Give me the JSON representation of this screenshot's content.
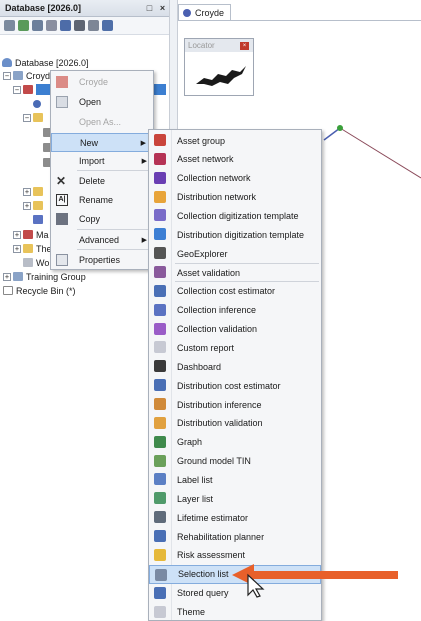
{
  "database_pane": {
    "title": "Database [2026.0]",
    "title_buttons": [
      "□",
      "×"
    ],
    "tree": {
      "root": "Database [2026.0]",
      "croydon_partial": "Croyd",
      "group_partial_1": "Ma",
      "group_partial_2": "The",
      "group_partial_3": "Wo",
      "training_group": "Training Group",
      "recycle_bin": "Recycle Bin (*)"
    }
  },
  "map_pane": {
    "tab_label": "Croyde",
    "locator_title": "Locator"
  },
  "context_menu": {
    "items": [
      {
        "label": "Croyde",
        "disabled": true
      },
      {
        "label": "Open",
        "disabled": false
      },
      {
        "label": "Open As...",
        "disabled": true
      },
      {
        "label": "New",
        "disabled": false,
        "submenu": true,
        "highlighted": true
      },
      {
        "label": "Import",
        "disabled": false,
        "submenu": true
      },
      {
        "label": "Delete",
        "disabled": false
      },
      {
        "label": "Rename",
        "disabled": false
      },
      {
        "label": "Copy",
        "disabled": false
      },
      {
        "label": "Advanced",
        "disabled": false,
        "submenu": true
      },
      {
        "label": "Properties",
        "disabled": false
      }
    ]
  },
  "new_submenu": {
    "items": [
      {
        "label": "Asset group",
        "icon": "asset-group-icon",
        "color": "#c9443b"
      },
      {
        "label": "Asset network",
        "icon": "asset-network-icon",
        "color": "#b53355"
      },
      {
        "label": "Collection network",
        "icon": "collection-network-icon",
        "color": "#6a3fb3"
      },
      {
        "label": "Distribution network",
        "icon": "distribution-network-icon",
        "color": "#e8a43a"
      },
      {
        "label": "Collection digitization template",
        "icon": "collection-template-icon",
        "color": "#7a6cc9"
      },
      {
        "label": "Distribution digitization template",
        "icon": "distribution-template-icon",
        "color": "#3d7fd4"
      },
      {
        "label": "GeoExplorer",
        "icon": "geoexplorer-icon",
        "color": "#555555"
      },
      {
        "label": "Asset validation",
        "icon": "asset-validation-icon",
        "color": "#8a5a9c"
      },
      {
        "label": "Collection cost estimator",
        "icon": "collection-cost-icon",
        "color": "#4a6fb5"
      },
      {
        "label": "Collection inference",
        "icon": "collection-inference-icon",
        "color": "#5a72c2"
      },
      {
        "label": "Collection validation",
        "icon": "collection-validation-icon",
        "color": "#9a5cc7"
      },
      {
        "label": "Custom report",
        "icon": "custom-report-icon",
        "color": "#c7c9d3"
      },
      {
        "label": "Dashboard",
        "icon": "dashboard-icon",
        "color": "#3a3a3a"
      },
      {
        "label": "Distribution cost estimator",
        "icon": "distribution-cost-icon",
        "color": "#4a6fb5"
      },
      {
        "label": "Distribution inference",
        "icon": "distribution-inference-icon",
        "color": "#d08a3a"
      },
      {
        "label": "Distribution validation",
        "icon": "distribution-validation-icon",
        "color": "#e1a13f"
      },
      {
        "label": "Graph",
        "icon": "graph-icon",
        "color": "#3f8a4c"
      },
      {
        "label": "Ground model TIN",
        "icon": "ground-model-icon",
        "color": "#6aa05a"
      },
      {
        "label": "Label list",
        "icon": "label-list-icon",
        "color": "#5b7fc4"
      },
      {
        "label": "Layer list",
        "icon": "layer-list-icon",
        "color": "#4f9a6a"
      },
      {
        "label": "Lifetime estimator",
        "icon": "lifetime-estimator-icon",
        "color": "#5f6b7a"
      },
      {
        "label": "Rehabilitation planner",
        "icon": "rehabilitation-planner-icon",
        "color": "#4a6fb5"
      },
      {
        "label": "Risk assessment",
        "icon": "risk-assessment-icon",
        "color": "#e6b93a"
      },
      {
        "label": "Selection list",
        "icon": "selection-list-icon",
        "color": "#7a8aa3"
      },
      {
        "label": "Stored query",
        "icon": "stored-query-icon",
        "color": "#4a6fb5"
      },
      {
        "label": "Theme",
        "icon": "theme-icon",
        "color": "#c7c9d3"
      }
    ]
  },
  "colors": {
    "highlight": "#cde1f7",
    "highlight_border": "#84acdd",
    "arrow": "#e8602a",
    "tree_selection": "#3c7fd1"
  }
}
